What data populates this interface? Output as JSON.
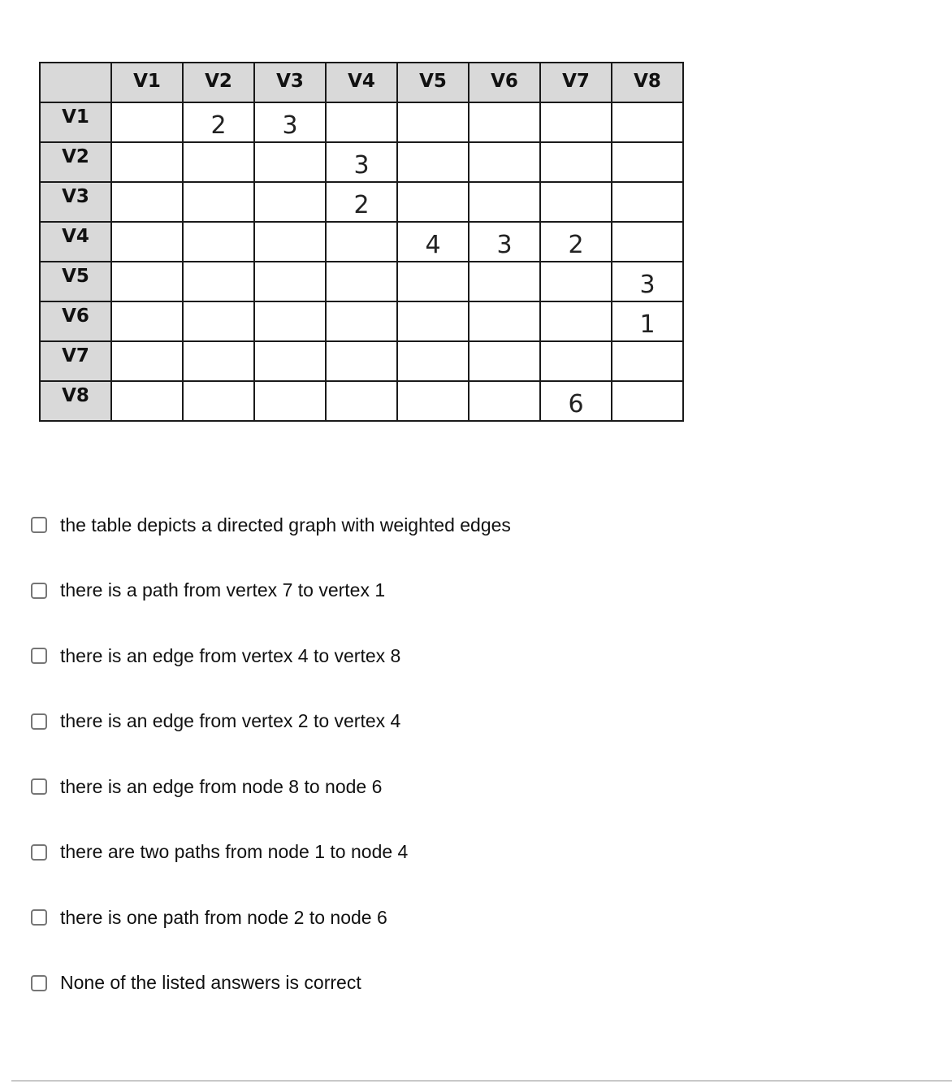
{
  "table": {
    "corner": "",
    "columns": [
      "V1",
      "V2",
      "V3",
      "V4",
      "V5",
      "V6",
      "V7",
      "V8"
    ],
    "rows": [
      {
        "label": "V1",
        "cells": [
          "",
          "2",
          "3",
          "",
          "",
          "",
          "",
          ""
        ]
      },
      {
        "label": "V2",
        "cells": [
          "",
          "",
          "",
          "3",
          "",
          "",
          "",
          ""
        ]
      },
      {
        "label": "V3",
        "cells": [
          "",
          "",
          "",
          "2",
          "",
          "",
          "",
          ""
        ]
      },
      {
        "label": "V4",
        "cells": [
          "",
          "",
          "",
          "",
          "4",
          "3",
          "2",
          ""
        ]
      },
      {
        "label": "V5",
        "cells": [
          "",
          "",
          "",
          "",
          "",
          "",
          "",
          "3"
        ]
      },
      {
        "label": "V6",
        "cells": [
          "",
          "",
          "",
          "",
          "",
          "",
          "",
          "1"
        ]
      },
      {
        "label": "V7",
        "cells": [
          "",
          "",
          "",
          "",
          "",
          "",
          "",
          ""
        ]
      },
      {
        "label": "V8",
        "cells": [
          "",
          "",
          "",
          "",
          "",
          "",
          "6",
          ""
        ]
      }
    ]
  },
  "options": [
    {
      "label": "the table depicts a directed graph with weighted edges",
      "checked": false
    },
    {
      "label": "there is a path from vertex 7 to vertex 1",
      "checked": false
    },
    {
      "label": "there is an edge from vertex 4 to vertex 8",
      "checked": false
    },
    {
      "label": "there is an edge from vertex 2 to vertex 4",
      "checked": false
    },
    {
      "label": "there is an edge from node 8 to node 6",
      "checked": false
    },
    {
      "label": "there are two paths from node 1 to node 4",
      "checked": false
    },
    {
      "label": "there is one path from node 2 to node 6",
      "checked": false
    },
    {
      "label": "None of the listed answers is correct",
      "checked": false
    }
  ]
}
